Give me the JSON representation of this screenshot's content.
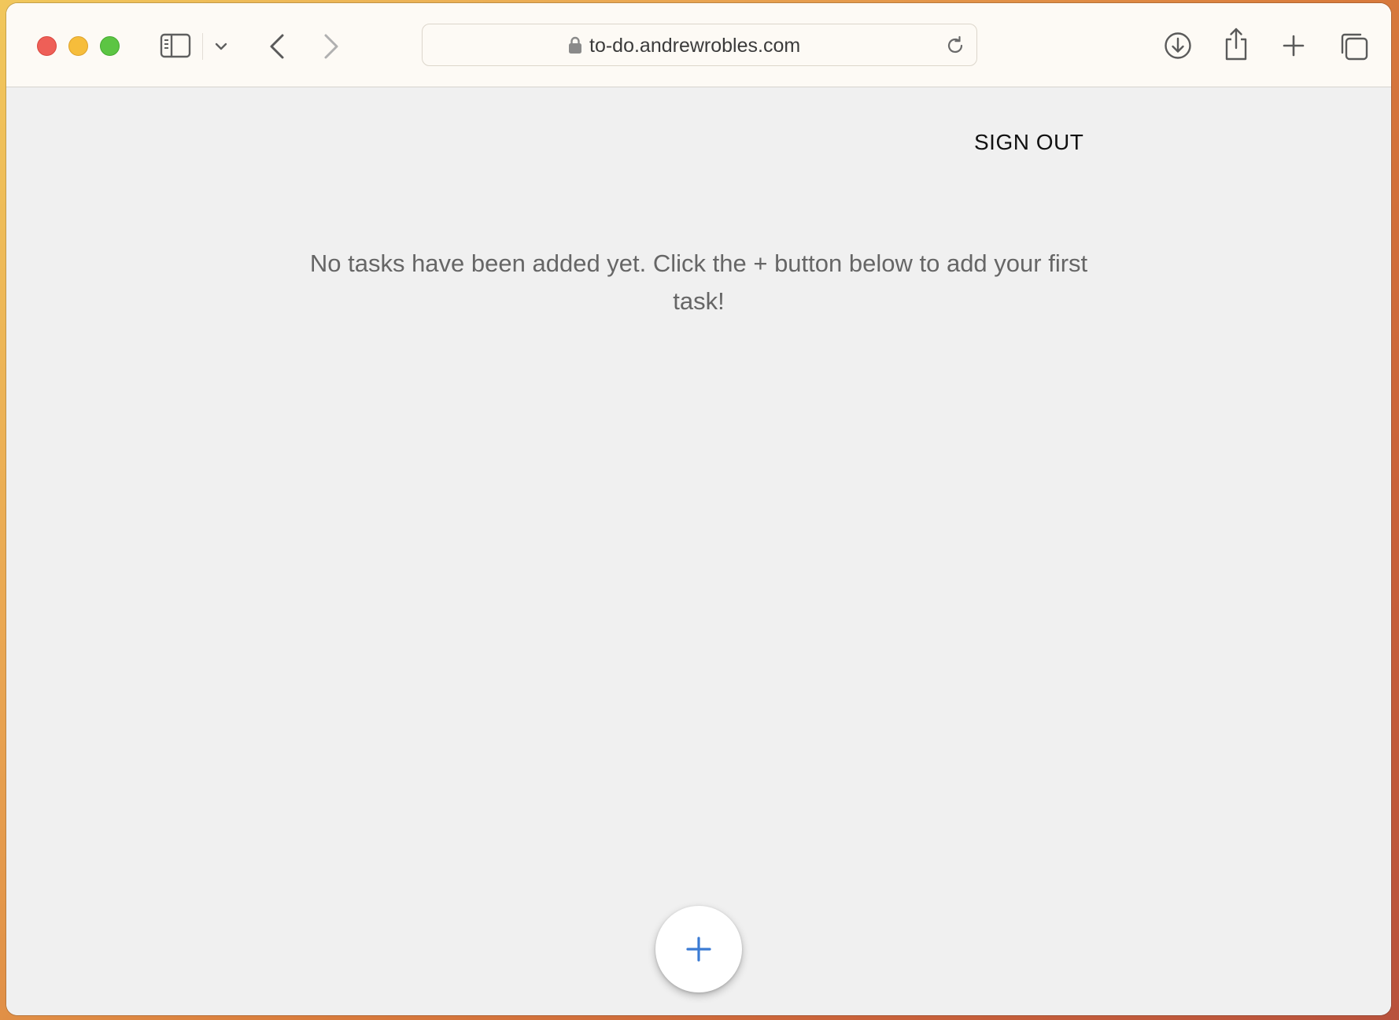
{
  "browser": {
    "address_bar": {
      "url": "to-do.andrewrobles.com",
      "lock_icon": "lock-icon",
      "reload_icon": "reload-icon"
    },
    "traffic_lights": [
      {
        "name": "close",
        "color": "#ee5f57"
      },
      {
        "name": "minimize",
        "color": "#f6bd3b"
      },
      {
        "name": "maximize",
        "color": "#5cc543"
      }
    ],
    "toolbar_icons": [
      "sidebar-icon",
      "chevron-down-icon",
      "back-arrow-icon",
      "forward-arrow-icon",
      "download-icon",
      "share-icon",
      "plus-icon",
      "tabs-overview-icon"
    ]
  },
  "app": {
    "sign_out_label": "SIGN OUT",
    "empty_state_message": "No tasks have been added yet. Click the + button below to add your first task!",
    "add_task_button": {
      "icon": "plus-icon",
      "accent_color": "#3b7bd4"
    }
  }
}
